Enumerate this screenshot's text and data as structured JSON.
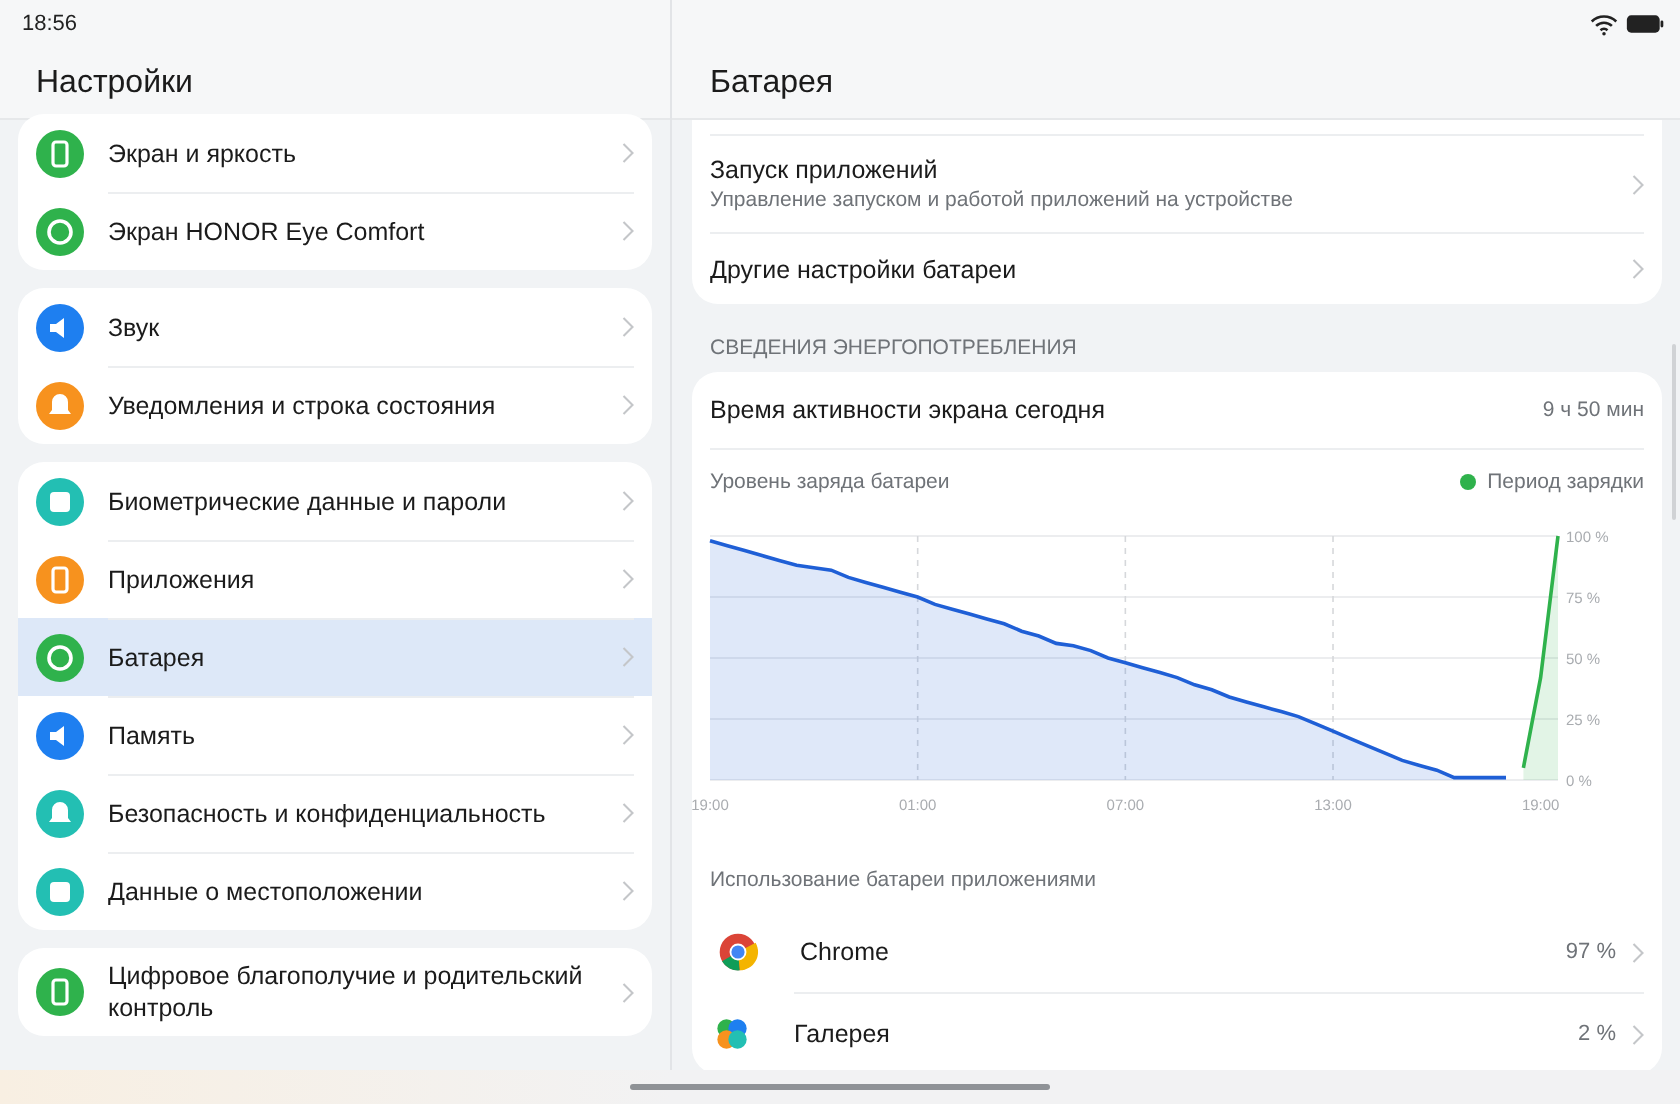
{
  "status_bar": {
    "time": "18:56"
  },
  "settings": {
    "title": "Настройки",
    "groups": [
      [
        {
          "label": "Экран и яркость",
          "color": "#2fb24c",
          "selected": false
        },
        {
          "label": "Экран HONOR Eye Comfort",
          "color": "#2fb24c",
          "selected": false
        }
      ],
      [
        {
          "label": "Звук",
          "color": "#1e7ff0",
          "selected": false
        },
        {
          "label": "Уведомления и строка состояния",
          "color": "#f7921e",
          "selected": false
        }
      ],
      [
        {
          "label": "Биометрические данные и пароли",
          "color": "#23bfb3",
          "selected": false
        },
        {
          "label": "Приложения",
          "color": "#f7921e",
          "selected": false
        },
        {
          "label": "Батарея",
          "color": "#2fb24c",
          "selected": true
        },
        {
          "label": "Память",
          "color": "#1e7ff0",
          "selected": false
        },
        {
          "label": "Безопасность и конфиденциальность",
          "color": "#23bfb3",
          "selected": false
        },
        {
          "label": "Данные о местоположении",
          "color": "#23bfb3",
          "selected": false
        }
      ],
      [
        {
          "label": "Цифровое благополучие и родительский контроль",
          "color": "#2fb24c",
          "selected": false
        }
      ]
    ]
  },
  "battery": {
    "title": "Батарея",
    "items": [
      {
        "label": "Запуск приложений",
        "description": "Управление запуском и работой приложений на устройстве"
      },
      {
        "label": "Другие настройки батареи"
      }
    ],
    "section_title": "СВЕДЕНИЯ ЭНЕРГОПОТРЕБЛЕНИЯ",
    "screen_time": {
      "label": "Время активности экрана сегодня",
      "value": "9 ч 50 мин"
    },
    "chart_data": {
      "type": "area",
      "grid": true,
      "categories": [
        "19:00",
        null,
        null,
        null,
        null,
        null,
        null,
        null,
        null,
        null,
        null,
        null,
        "01:00",
        null,
        null,
        null,
        null,
        null,
        null,
        null,
        null,
        null,
        null,
        null,
        "07:00",
        null,
        null,
        null,
        null,
        null,
        null,
        null,
        null,
        null,
        null,
        null,
        "13:00",
        null,
        null,
        null,
        null,
        null,
        null,
        null,
        null,
        null,
        null,
        null,
        "19:00",
        null
      ],
      "series": [
        {
          "name": "Уровень заряда батареи",
          "color": "#1f5fd6",
          "values": [
            98,
            96,
            94,
            92,
            90,
            88,
            87,
            86,
            83,
            81,
            79,
            77,
            75,
            72,
            70,
            68,
            66,
            64,
            61,
            59,
            56,
            55,
            53,
            50,
            48,
            46,
            44,
            42,
            39,
            37,
            34,
            32,
            30,
            28,
            26,
            23,
            20,
            17,
            14,
            11,
            8,
            6,
            4,
            1,
            1,
            1,
            1,
            null,
            null,
            null
          ]
        },
        {
          "name": "Период зарядки",
          "color": "#2fb24c",
          "values": [
            null,
            null,
            null,
            null,
            null,
            null,
            null,
            null,
            null,
            null,
            null,
            null,
            null,
            null,
            null,
            null,
            null,
            null,
            null,
            null,
            null,
            null,
            null,
            null,
            null,
            null,
            null,
            null,
            null,
            null,
            null,
            null,
            null,
            null,
            null,
            null,
            null,
            null,
            null,
            null,
            null,
            null,
            null,
            null,
            null,
            null,
            null,
            5,
            42,
            100
          ]
        }
      ],
      "ylim": [
        0,
        100
      ],
      "yticks": [
        {
          "value": 0,
          "label": "0 %"
        },
        {
          "value": 25,
          "label": "25 %"
        },
        {
          "value": 50,
          "label": "50 %"
        },
        {
          "value": 75,
          "label": "75 %"
        },
        {
          "value": 100,
          "label": "100 %"
        }
      ]
    },
    "apps_title": "Использование батареи приложениями",
    "apps": [
      {
        "name": "Chrome",
        "usage": "97 %"
      },
      {
        "name": "Галерея",
        "usage": "2 %"
      }
    ]
  }
}
